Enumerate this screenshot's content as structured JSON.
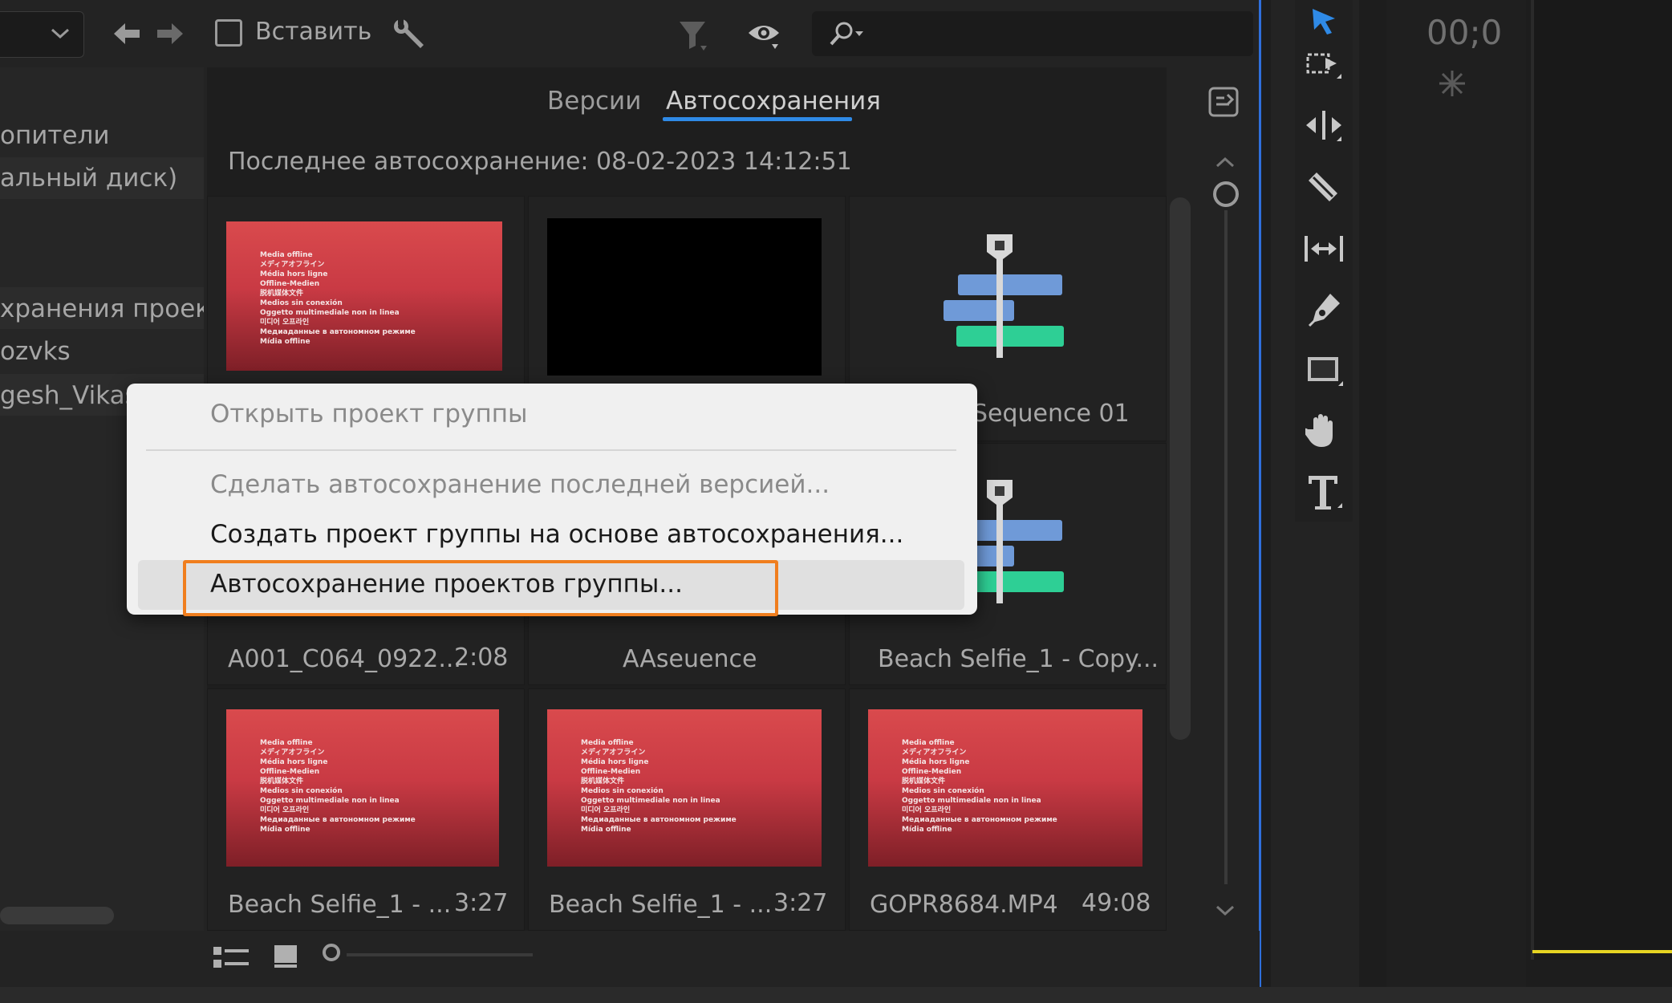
{
  "toolbar": {
    "insert_label": "Вставить",
    "icons": [
      "chevron-down-icon",
      "arrow-left-icon",
      "arrow-right-icon",
      "checkbox-icon",
      "wrench-icon",
      "filter-icon",
      "eye-icon",
      "search-icon"
    ]
  },
  "tree": {
    "items": [
      "опители",
      "альный диск)",
      "",
      "хранения проектов",
      "ozvks",
      "gesh_Vikas"
    ]
  },
  "tabs": {
    "versions": "Версии",
    "autosaves": "Автосохранения"
  },
  "last_autosave": "Последнее автосохранение: 08-02-2023 14:12:51",
  "offline_lines": [
    "Media offline",
    "メディアオフライン",
    "Média hors ligne",
    "Offline-Medien",
    "脱机媒体文件",
    "Medios sin conexión",
    "Oggetto multimediale non in linea",
    "미디어 오프라인",
    "Медиаданные в автономном режиме",
    "Mídia offline"
  ],
  "tiles": [
    {
      "name": "",
      "duration": ""
    },
    {
      "name": "",
      "duration": ""
    },
    {
      "name": "Sequence 01",
      "duration": ""
    },
    {
      "name": "A001_C064_0922...",
      "duration": "2:08"
    },
    {
      "name": "AAseuence",
      "duration": ""
    },
    {
      "name": "Beach Selfie_1 - Copy...",
      "duration": ""
    },
    {
      "name": "Beach Selfie_1 - ...",
      "duration": "3:27"
    },
    {
      "name": "Beach Selfie_1 - ...",
      "duration": "3:27"
    },
    {
      "name": "GOPR8684.MP4",
      "duration": "49:08"
    }
  ],
  "context_menu": {
    "open_team_project": "Открыть проект группы",
    "make_latest": "Сделать автосохранение последней версией...",
    "create_from_autosave": "Создать проект группы на основе автосохранения...",
    "team_autosaves": "Автосохранение проектов группы..."
  },
  "timeline": {
    "timecode": "00;0"
  },
  "colors": {
    "accent_blue": "#2f8ae6",
    "highlight_orange": "#f07e1e",
    "playhead_yellow": "#e5d322",
    "seq_blue": "#6f9ad8",
    "seq_green": "#2ecf95"
  }
}
